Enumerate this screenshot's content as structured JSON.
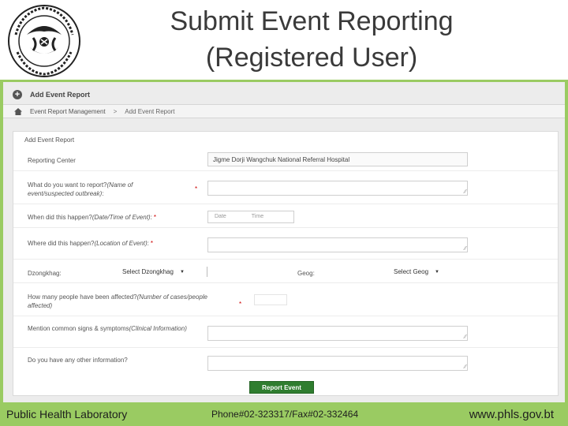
{
  "slide": {
    "title": "Submit Event Reporting\n(Registered User)",
    "colors": {
      "accent": "#9acb62",
      "button": "#2f7d2f"
    }
  },
  "app": {
    "heading": "Add Event Report",
    "breadcrumb": {
      "parent": "Event Report Management",
      "separator": ">",
      "current": "Add Event Report"
    },
    "form": {
      "title": "Add Event Report",
      "reporting_center_label": "Reporting Center",
      "reporting_center_value": "Jigme Dorji Wangchuk National Referral Hospital",
      "what_label": "What do you want to report?",
      "what_hint": "(Name of event/suspected outbreak)",
      "what_suffix": ":",
      "when_label": "When did this happen?",
      "when_hint": "(Date/Time of Event)",
      "when_suffix": ":",
      "date_placeholder": "Date",
      "time_placeholder": "Time",
      "where_label": "Where did this happen?",
      "where_hint": "(Location of Event)",
      "where_suffix": ":",
      "dzongkhag_label": "Dzongkhag:",
      "dzongkhag_value": "Select Dzongkhag",
      "gewog_label": "Geog:",
      "gewog_value": "Select Geog",
      "affected_label": "How many people have been affected?",
      "affected_hint": "(Number of cases/people affected)",
      "signs_label": "Mention common signs & symptoms",
      "signs_hint": "(Clinical Information)",
      "other_label": "Do you have any other information?",
      "required_mark": "*",
      "submit_label": "Report Event"
    }
  },
  "footer": {
    "org": "Public Health Laboratory",
    "contact": "Phone#02-323317/Fax#02-332464",
    "website": "www.phls.gov.bt"
  },
  "icons": [
    "emblem-logo",
    "plus-circle-icon",
    "home-icon",
    "caret-down-icon"
  ]
}
